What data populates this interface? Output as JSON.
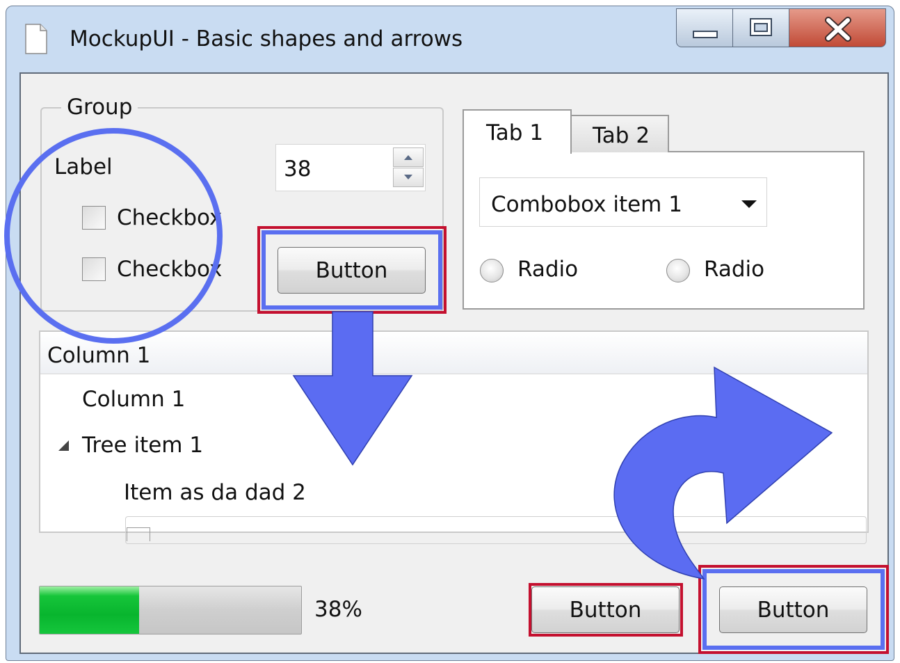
{
  "window": {
    "title": "MockupUI - Basic shapes and arrows",
    "icon": "document-icon",
    "controls": [
      "minimize-icon",
      "maximize-icon",
      "close-icon"
    ]
  },
  "group": {
    "legend": "Group",
    "label": "Label",
    "checkboxes": [
      {
        "label": "Checkbox",
        "checked": false
      },
      {
        "label": "Checkbox",
        "checked": false
      }
    ],
    "spinbox_value": "38",
    "button_label": "Button"
  },
  "tabs": {
    "items": [
      "Tab 1",
      "Tab 2"
    ],
    "active": "Tab 1",
    "combobox_value": "Combobox item 1",
    "radios": [
      {
        "label": "Radio",
        "selected": false
      },
      {
        "label": "Radio",
        "selected": false
      }
    ]
  },
  "tree": {
    "header": "Column 1",
    "rows": [
      "Column 1",
      "Tree item 1",
      "Item as da dad 2"
    ]
  },
  "progress": {
    "value": 0.38,
    "text": "38%"
  },
  "bottom_buttons": [
    "Button",
    "Button"
  ],
  "annotation_colors": {
    "highlight_blue": "#5a6ff0",
    "highlight_red": "#c4102f",
    "progress_green": "#08b52e"
  }
}
